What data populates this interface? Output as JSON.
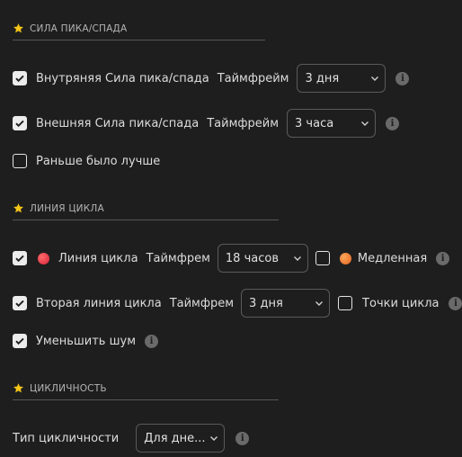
{
  "sections": {
    "peak": {
      "title": "СИЛА ПИКА/СПАДА"
    },
    "cycle": {
      "title": "ЛИНИЯ ЦИКЛА"
    },
    "cyclicity": {
      "title": "ЦИКЛИЧНОСТЬ"
    }
  },
  "peak": {
    "internal": {
      "label": "Внутряняя Сила пика/спада",
      "checked": true,
      "tf_label": "Таймфрейм",
      "tf_value": "3 дня"
    },
    "external": {
      "label": "Внешняя Сила пика/спада",
      "checked": true,
      "tf_label": "Таймфрейм",
      "tf_value": "3 часа"
    },
    "earlier": {
      "label": "Раньше было лучше",
      "checked": false
    }
  },
  "cycle": {
    "line": {
      "label": "Линия цикла",
      "checked": true,
      "color": "#e8303f",
      "tf_label": "Таймфрем",
      "tf_value": "18 часов"
    },
    "slow": {
      "label": "Медленная",
      "checked": false,
      "color": "#f07a2a"
    },
    "second": {
      "label": "Вторая линия цикла",
      "checked": true,
      "tf_label": "Таймфрем",
      "tf_value": "3 дня"
    },
    "points": {
      "label": "Точки цикла",
      "checked": false
    },
    "noise": {
      "label": "Уменьшить шум",
      "checked": true
    }
  },
  "cyclicity": {
    "type": {
      "label": "Тип цикличности",
      "value": "Для дне..."
    }
  },
  "icons": {
    "section": "star-icon",
    "info": "info-icon",
    "dropdown": "chevron-down-icon",
    "check": "check-icon"
  },
  "colors": {
    "background": "#1e1e1e",
    "star": "#f5c518",
    "checkbox": "#ececec"
  }
}
